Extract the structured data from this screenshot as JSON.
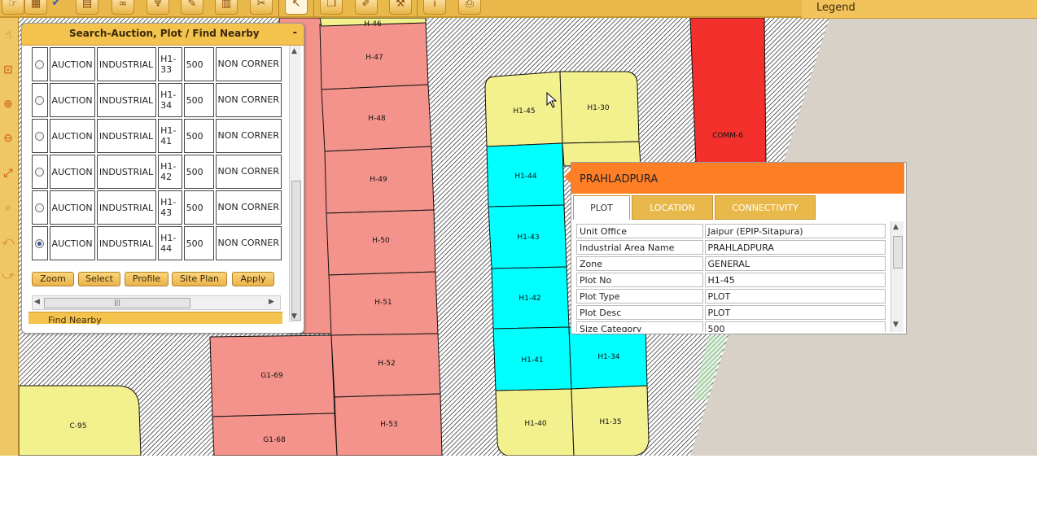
{
  "toolbar": {
    "icons": [
      "pan-tool-icon",
      "print-area-icon",
      "checkbox-icon",
      "grid-tool-icon",
      "binoculars-icon",
      "pin-icon",
      "draw-icon",
      "measure-icon",
      "clear-icon",
      "select-icon",
      "layers-icon",
      "edit-icon",
      "settings-icon",
      "info-icon",
      "print-icon"
    ]
  },
  "legend": {
    "title": "Legend"
  },
  "left_tools": [
    "identify-icon",
    "zoom-box-icon",
    "zoom-in-icon",
    "zoom-out-icon",
    "full-extent-icon",
    "search-icon",
    "zoom-prev-icon",
    "zoom-next-icon"
  ],
  "search_panel": {
    "title": "Search-Auction, Plot / Find Nearby",
    "minimize": "-",
    "rows": [
      {
        "type": "AUCTION",
        "category": "INDUSTRIAL",
        "plot": "H1-33",
        "size": "500",
        "corner": "NON CORNER",
        "selected": false
      },
      {
        "type": "AUCTION",
        "category": "INDUSTRIAL",
        "plot": "H1-34",
        "size": "500",
        "corner": "NON CORNER",
        "selected": false
      },
      {
        "type": "AUCTION",
        "category": "INDUSTRIAL",
        "plot": "H1-41",
        "size": "500",
        "corner": "NON CORNER",
        "selected": false
      },
      {
        "type": "AUCTION",
        "category": "INDUSTRIAL",
        "plot": "H1-42",
        "size": "500",
        "corner": "NON CORNER",
        "selected": false
      },
      {
        "type": "AUCTION",
        "category": "INDUSTRIAL",
        "plot": "H1-43",
        "size": "500",
        "corner": "NON CORNER",
        "selected": false
      },
      {
        "type": "AUCTION",
        "category": "INDUSTRIAL",
        "plot": "H1-44",
        "size": "500",
        "corner": "NON CORNER",
        "selected": true
      }
    ],
    "buttons": {
      "zoom": "Zoom",
      "select": "Select",
      "profile": "Profile",
      "site_plan": "Site Plan",
      "apply": "Apply"
    },
    "find_nearby": "Find Nearby"
  },
  "popup": {
    "title": "PRAHLADPURA",
    "tabs": [
      "PLOT",
      "LOCATION",
      "CONNECTIVITY"
    ],
    "attributes": [
      {
        "key": "Unit Office",
        "value": "Jaipur (EPIP-Sitapura)"
      },
      {
        "key": "Industrial Area Name",
        "value": "PRAHLADPURA"
      },
      {
        "key": "Zone",
        "value": "GENERAL"
      },
      {
        "key": "Plot No",
        "value": "H1-45"
      },
      {
        "key": "Plot Type",
        "value": "PLOT"
      },
      {
        "key": "Plot Desc",
        "value": "PLOT"
      },
      {
        "key": "Size Category",
        "value": "500"
      }
    ]
  },
  "map": {
    "colors": {
      "pink": "#f4938c",
      "yellow": "#f3f08e",
      "cyan": "#00ffff",
      "red": "#f3302c",
      "hatch": "#000000",
      "green": "#cfe8cf"
    },
    "plot_labels": {
      "h46": "H-46",
      "h47": "H-47",
      "h48": "H-48",
      "h49": "H-49",
      "h50": "H-50",
      "h51": "H-51",
      "h52": "H-52",
      "h53": "H-53",
      "h145": "H1-45",
      "h130": "H1-30",
      "h144": "H1-44",
      "h143": "H1-43",
      "h142": "H1-42",
      "h141": "H1-41",
      "h134": "H1-34",
      "h140": "H1-40",
      "h135": "H1-35",
      "comm6": "COMM-6",
      "g169": "G1-69",
      "g168": "G1-68",
      "c95": "C-95"
    }
  }
}
